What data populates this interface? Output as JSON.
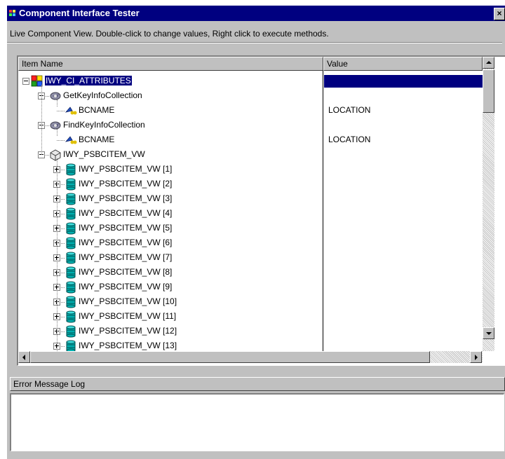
{
  "window": {
    "title": "Component Interface Tester",
    "close_label": "×"
  },
  "info_text": "Live Component View.   Double-click to change values, Right click to execute methods.",
  "tree": {
    "columns": {
      "item_name": "Item Name",
      "value": "Value"
    },
    "rows": [
      {
        "label": "IWY_CI_ATTRIBUTES",
        "value": "",
        "icon": "component-interface-icon",
        "selected": true,
        "expander": "minus"
      },
      {
        "label": "GetKeyInfoCollection",
        "value": "",
        "icon": "key-collection-icon",
        "expander": "minus"
      },
      {
        "label": "BCNAME",
        "value": "LOCATION",
        "icon": "key-field-icon"
      },
      {
        "label": "FindKeyInfoCollection",
        "value": "",
        "icon": "key-collection-icon",
        "expander": "minus"
      },
      {
        "label": "BCNAME",
        "value": "LOCATION",
        "icon": "key-field-icon"
      },
      {
        "label": "IWY_PSBCITEM_VW",
        "value": "",
        "icon": "collection-box-icon",
        "expander": "minus"
      },
      {
        "label": "IWY_PSBCITEM_VW [1]",
        "value": "",
        "icon": "database-icon",
        "expander": "plus"
      },
      {
        "label": "IWY_PSBCITEM_VW [2]",
        "value": "",
        "icon": "database-icon",
        "expander": "plus"
      },
      {
        "label": "IWY_PSBCITEM_VW [3]",
        "value": "",
        "icon": "database-icon",
        "expander": "plus"
      },
      {
        "label": "IWY_PSBCITEM_VW [4]",
        "value": "",
        "icon": "database-icon",
        "expander": "plus"
      },
      {
        "label": "IWY_PSBCITEM_VW [5]",
        "value": "",
        "icon": "database-icon",
        "expander": "plus"
      },
      {
        "label": "IWY_PSBCITEM_VW [6]",
        "value": "",
        "icon": "database-icon",
        "expander": "plus"
      },
      {
        "label": "IWY_PSBCITEM_VW [7]",
        "value": "",
        "icon": "database-icon",
        "expander": "plus"
      },
      {
        "label": "IWY_PSBCITEM_VW [8]",
        "value": "",
        "icon": "database-icon",
        "expander": "plus"
      },
      {
        "label": "IWY_PSBCITEM_VW [9]",
        "value": "",
        "icon": "database-icon",
        "expander": "plus"
      },
      {
        "label": "IWY_PSBCITEM_VW [10]",
        "value": "",
        "icon": "database-icon",
        "expander": "plus"
      },
      {
        "label": "IWY_PSBCITEM_VW [11]",
        "value": "",
        "icon": "database-icon",
        "expander": "plus"
      },
      {
        "label": "IWY_PSBCITEM_VW [12]",
        "value": "",
        "icon": "database-icon",
        "expander": "plus"
      },
      {
        "label": "IWY_PSBCITEM_VW [13]",
        "value": "",
        "icon": "database-icon",
        "expander": "plus"
      }
    ]
  },
  "error_log": {
    "title": "Error Message Log",
    "content": ""
  },
  "colors": {
    "titlebar": "#000080",
    "selection": "#000080",
    "face": "#c0c0c0",
    "database_icon": "#00a8a8"
  }
}
